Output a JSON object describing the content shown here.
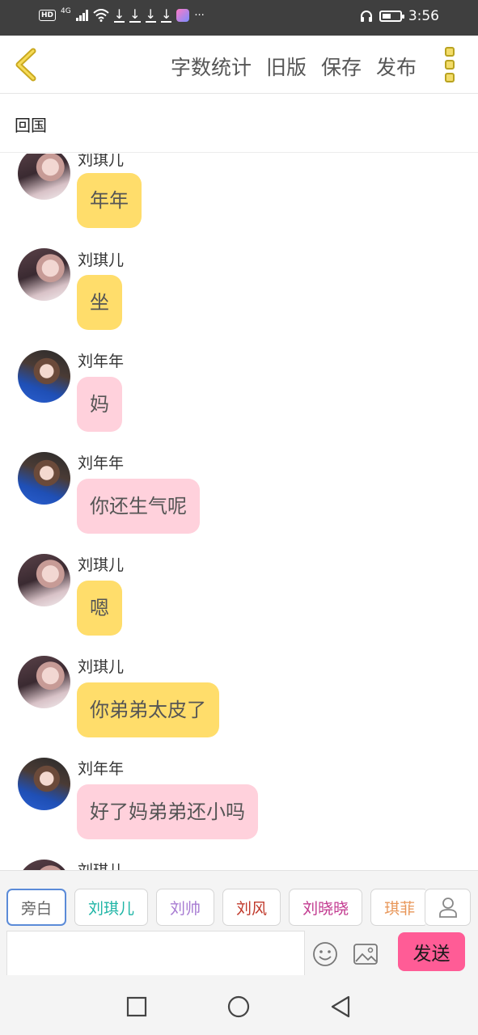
{
  "status_bar": {
    "network": "4G",
    "time": "3:56"
  },
  "toolbar": {
    "back_icon": "chevron-left-icon",
    "actions": [
      "字数统计",
      "旧版",
      "保存",
      "发布"
    ],
    "more_icon": "more-vertical-icon"
  },
  "title": "回国",
  "messages": [
    {
      "name": "刘琪儿",
      "text": "年年",
      "color": "yellow",
      "avatar": "qier"
    },
    {
      "name": "刘琪儿",
      "text": "坐",
      "color": "yellow",
      "avatar": "qier"
    },
    {
      "name": "刘年年",
      "text": "妈",
      "color": "pink",
      "avatar": "niannian"
    },
    {
      "name": "刘年年",
      "text": "你还生气呢",
      "color": "pink",
      "avatar": "niannian"
    },
    {
      "name": "刘琪儿",
      "text": "嗯",
      "color": "yellow",
      "avatar": "qier"
    },
    {
      "name": "刘琪儿",
      "text": "你弟弟太皮了",
      "color": "yellow",
      "avatar": "qier"
    },
    {
      "name": "刘年年",
      "text": "好了妈弟弟还小吗",
      "color": "pink",
      "avatar": "niannian"
    },
    {
      "name": "刘琪儿",
      "text": "",
      "color": "yellow",
      "avatar": "qier"
    }
  ],
  "roles": [
    {
      "label": "旁白",
      "color": "#666666",
      "active": true
    },
    {
      "label": "刘琪儿",
      "color": "#1fb5a6",
      "active": false
    },
    {
      "label": "刘帅",
      "color": "#a77bd2",
      "active": false
    },
    {
      "label": "刘风",
      "color": "#c0392b",
      "active": false
    },
    {
      "label": "刘晓晓",
      "color": "#c2398f",
      "active": false
    },
    {
      "label": "琪菲",
      "color": "#e8975a",
      "active": false
    }
  ],
  "input": {
    "value": "",
    "placeholder": ""
  },
  "send_label": "发送",
  "colors": {
    "yellow_bubble": "#ffdd6b",
    "pink_bubble": "#ffd1dc",
    "send": "#ff5c96"
  }
}
